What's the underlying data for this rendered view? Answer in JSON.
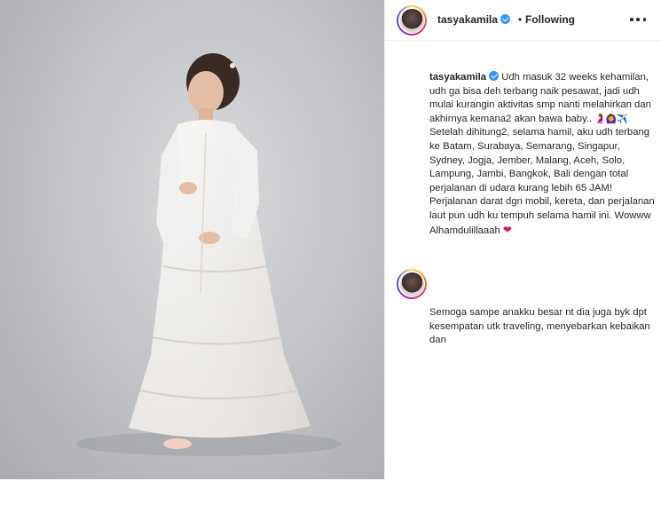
{
  "post": {
    "username": "tasyakamila",
    "separator": "•",
    "follow_status": "Following",
    "caption_part1": "Udh masuk 32 weeks kehamilan, udh ga bisa deh terbang naik pesawat, jadi udh mulai kurangin aktivitas smp nanti melahirkan dan akhirnya kemana2 akan bawa baby.. ",
    "caption_emojis": "🤰🙆‍♀️✈️",
    "caption_part2": " Setelah dihitung2, selama hamil, aku udh terbang ke Batam, Surabaya, Semarang, Singapur, Sydney, Jogja, Jember, Malang, Aceh, Solo, Lampung, Jambi, Bangkok, Bali dengan total perjalanan di udara kurang lebih 65 JAM! Perjalanan darat dgn mobil, kereta, dan perjalanan laut pun udh ku tempuh selama hamil ini. Wowww Alhamdulillaaah ",
    "caption_heart": "❤",
    "caption_continued": "Semoga sampe anakku besar nt dia juga byk dpt kesempatan utk traveling, menyebarkan kebaikan dan"
  },
  "icons": {
    "verified": "verified-badge-icon",
    "more": "more-options-icon"
  },
  "colors": {
    "verified_blue": "#3897f0",
    "heart_red": "#d11b4a",
    "text": "#262626",
    "border": "#efefef",
    "photo_background": "#c4c6c9"
  }
}
